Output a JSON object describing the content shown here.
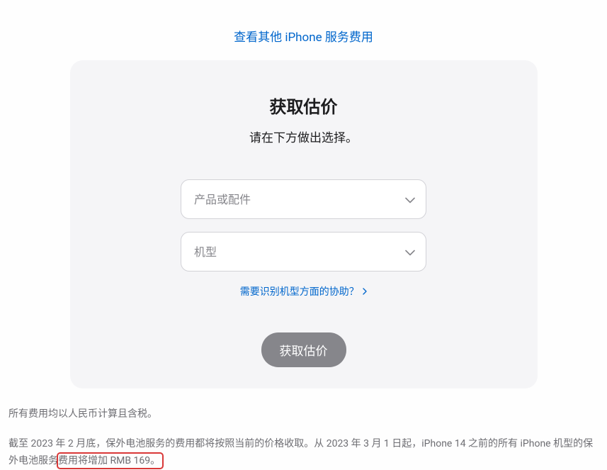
{
  "topLink": "查看其他 iPhone 服务费用",
  "card": {
    "title": "获取估价",
    "subtitle": "请在下方做出选择。",
    "select1": "产品或配件",
    "select2": "机型",
    "help": "需要识别机型方面的协助？",
    "cta": "获取估价"
  },
  "footer": {
    "line1": "所有费用均以人民币计算且含税。",
    "line2a": "截至 2023 年 2 月底，保外电池服务的费用都将按照当前的价格收取。从 2023 年 3 月 1 日起，iPhone 14 之前的所有 iPhone 机型的保外电池服务",
    "line2b": "费用将增加 RMB 169。"
  }
}
